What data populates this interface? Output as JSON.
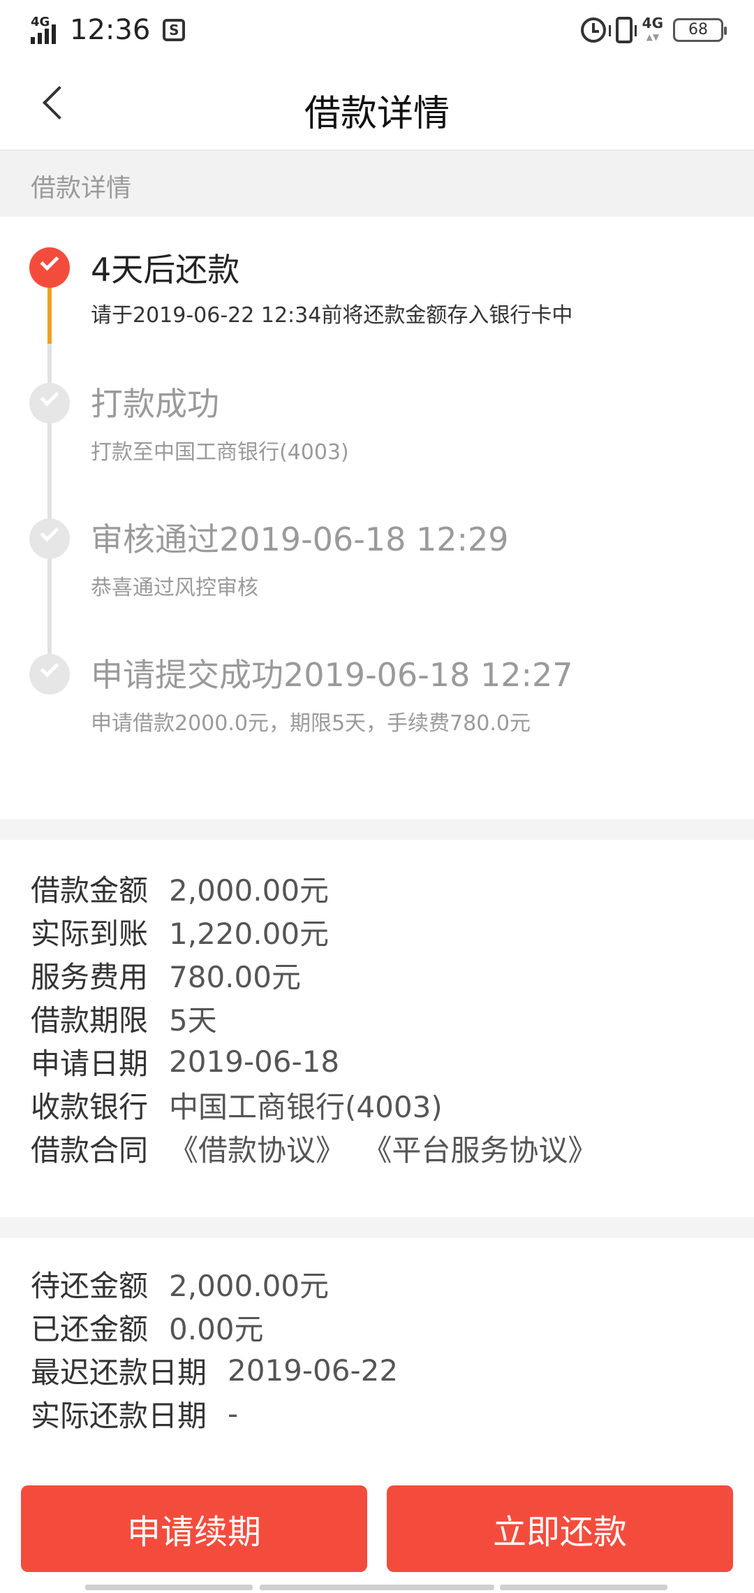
{
  "status_bar": {
    "network_left": "4G",
    "time": "12:36",
    "notification_icon_text": "S",
    "network_right": "4G",
    "battery": "68"
  },
  "nav": {
    "title": "借款详情"
  },
  "section_header": "借款详情",
  "timeline": [
    {
      "title": "4天后还款",
      "desc": "请于2019-06-22 12:34前将还款金额存入银行卡中",
      "active": true
    },
    {
      "title": "打款成功",
      "desc": "打款至中国工商银行(4003)",
      "active": false
    },
    {
      "title": "审核通过2019-06-18 12:29",
      "desc": "恭喜通过风控审核",
      "active": false
    },
    {
      "title": "申请提交成功2019-06-18 12:27",
      "desc": "申请借款2000.0元，期限5天，手续费780.0元",
      "active": false
    }
  ],
  "loan_info": {
    "amount_label": "借款金额",
    "amount_value": "2,000.00元",
    "received_label": "实际到账",
    "received_value": "1,220.00元",
    "fee_label": "服务费用",
    "fee_value": "780.00元",
    "term_label": "借款期限",
    "term_value": "5天",
    "apply_date_label": "申请日期",
    "apply_date_value": "2019-06-18",
    "bank_label": "收款银行",
    "bank_value": "中国工商银行(4003)",
    "contract_label": "借款合同",
    "contract_link_1": "《借款协议》",
    "contract_link_2": "《平台服务协议》"
  },
  "repay_info": {
    "pending_label": "待还金额",
    "pending_value": "2,000.00元",
    "repaid_label": "已还金额",
    "repaid_value": "0.00元",
    "due_label": "最迟还款日期",
    "due_value": "2019-06-22",
    "actual_label": "实际还款日期",
    "actual_value": "-"
  },
  "buttons": {
    "renew": "申请续期",
    "repay": "立即还款"
  },
  "colors": {
    "accent": "#f44c3c",
    "timeline_active_line": "#f0a020",
    "inactive": "#9a9a9a"
  }
}
